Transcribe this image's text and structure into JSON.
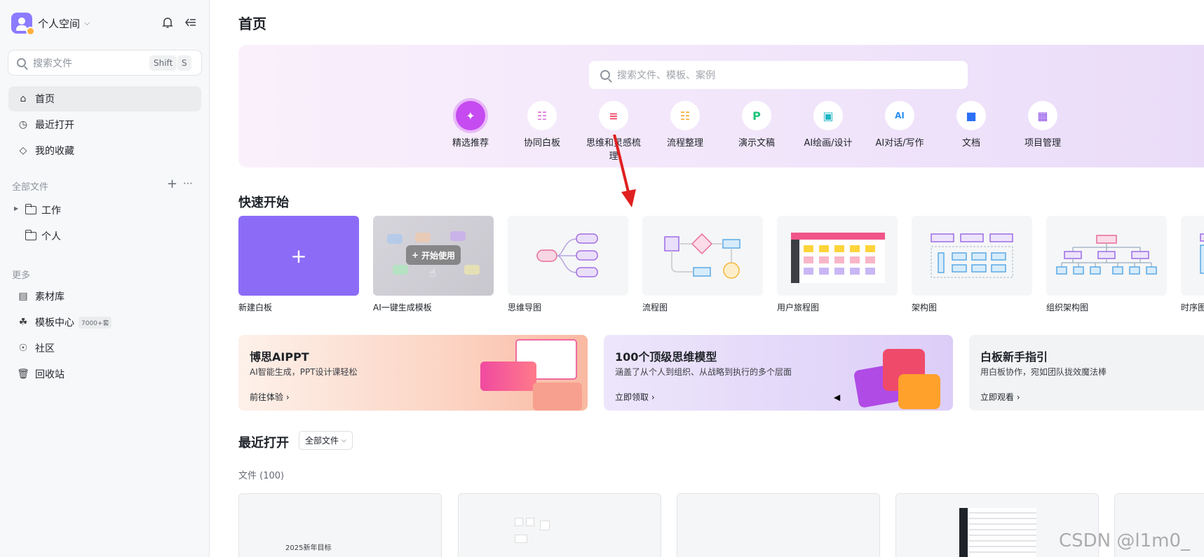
{
  "sidebar": {
    "workspace_name": "个人空间",
    "search_placeholder": "搜索文件",
    "search_key1": "Shift",
    "search_key2": "S",
    "nav": [
      {
        "label": "首页",
        "icon": "home-icon"
      },
      {
        "label": "最近打开",
        "icon": "clock-icon"
      },
      {
        "label": "我的收藏",
        "icon": "tag-icon"
      }
    ],
    "all_files_label": "全部文件",
    "folders": [
      "工作",
      "个人"
    ],
    "more_label": "更多",
    "more_items": [
      {
        "label": "素材库",
        "icon": "library-icon"
      },
      {
        "label": "模板中心",
        "icon": "template-icon",
        "tag": "7000+套"
      },
      {
        "label": "社区",
        "icon": "community-icon"
      },
      {
        "label": "回收站",
        "icon": "trash-icon"
      }
    ]
  },
  "main": {
    "title": "首页",
    "banner_search_placeholder": "搜索文件、模板、案例",
    "categories": [
      "精选推荐",
      "协同白板",
      "思维和灵感梳理",
      "流程整理",
      "演示文稿",
      "AI绘画/设计",
      "AI对话/写作",
      "文档",
      "项目管理"
    ],
    "quick_start_title": "快速开始",
    "templates": [
      "新建白板",
      "AI一键生成模板",
      "思维导图",
      "流程图",
      "用户旅程图",
      "架构图",
      "组织架构图",
      "时序图"
    ],
    "ai_template_button": "开始使用",
    "promos": [
      {
        "title": "博思AIPPT",
        "subtitle": "AI智能生成，PPT设计课轻松",
        "link": "前往体验"
      },
      {
        "title": "100个顶级思维模型",
        "subtitle": "涵盖了从个人到组织、从战略到执行的多个层面",
        "link": "立即领取"
      },
      {
        "title": "白板新手指引",
        "subtitle": "用白板协作，宛如团队拢效魔法棒",
        "link": "立即观看"
      }
    ],
    "recent_title": "最近打开",
    "recent_filter": "全部文件",
    "file_count": "文件 (100)",
    "first_file_text": "2025新年目标"
  },
  "watermark": "CSDN @l1m0_",
  "colors": {
    "accent": "#8c6cf7",
    "selected_category": "#c64bf0",
    "arrow": "#e02020"
  }
}
